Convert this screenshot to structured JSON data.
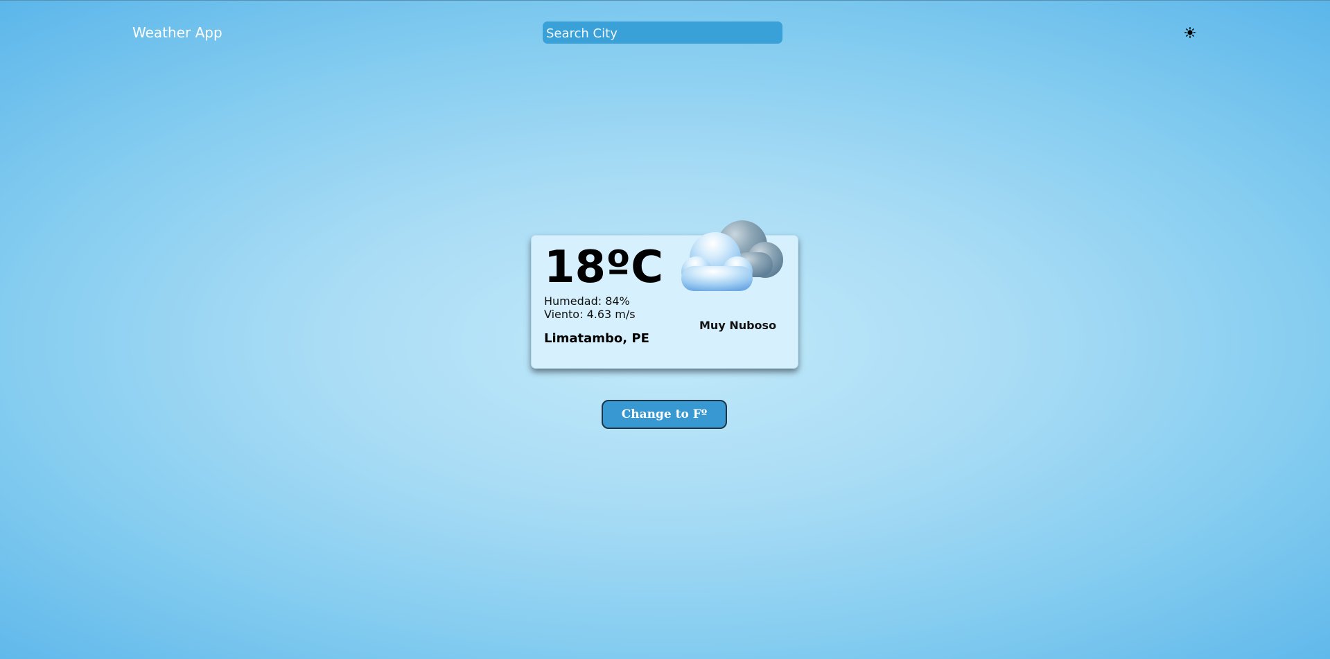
{
  "header": {
    "app_title": "Weather App",
    "search_placeholder": "Search City",
    "theme_toggle_icon": "sun-icon"
  },
  "weather": {
    "temperature": "18ºC",
    "humidity": "Humedad: 84%",
    "wind": "Viento: 4.63 m/s",
    "location": "Limatambo, PE",
    "description": "Muy Nuboso",
    "icon": "broken-clouds-icon"
  },
  "controls": {
    "unit_button_label": "Change to Fº"
  },
  "colors": {
    "search_bg": "#3aa0d8",
    "card_bg": "#d6f1fd",
    "button_bg": "#3798d2"
  }
}
